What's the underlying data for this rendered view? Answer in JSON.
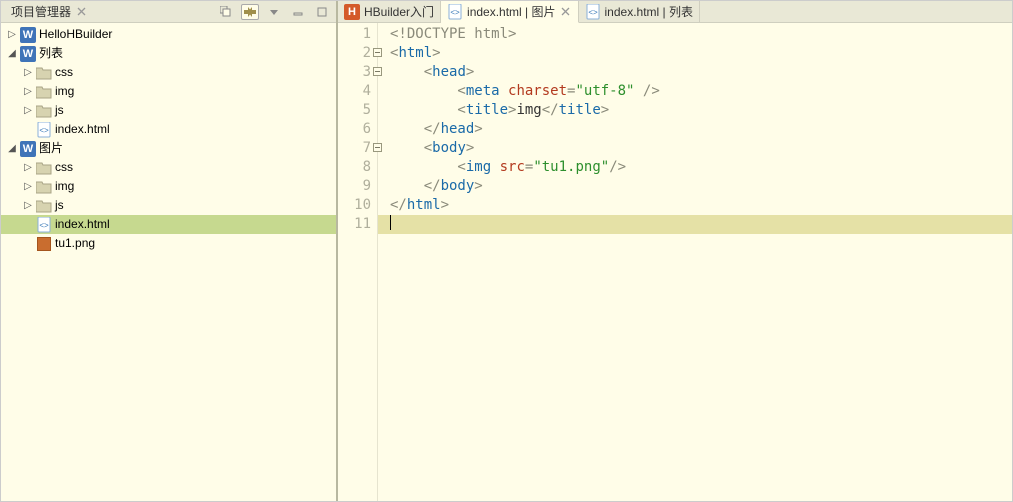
{
  "leftPanel": {
    "title": "项目管理器",
    "nodes": [
      {
        "id": "n0",
        "depth": 0,
        "expanded": false,
        "iconType": "w",
        "label": "HelloHBuilder"
      },
      {
        "id": "n1",
        "depth": 0,
        "expanded": true,
        "iconType": "w",
        "label": "列表"
      },
      {
        "id": "n2",
        "depth": 1,
        "expanded": false,
        "iconType": "folder",
        "label": "css"
      },
      {
        "id": "n3",
        "depth": 1,
        "expanded": false,
        "iconType": "folder",
        "label": "img"
      },
      {
        "id": "n4",
        "depth": 1,
        "expanded": false,
        "iconType": "folder",
        "label": "js"
      },
      {
        "id": "n5",
        "depth": 1,
        "iconType": "html",
        "label": "index.html"
      },
      {
        "id": "n6",
        "depth": 0,
        "expanded": true,
        "iconType": "w",
        "label": "图片"
      },
      {
        "id": "n7",
        "depth": 1,
        "expanded": false,
        "iconType": "folder",
        "label": "css"
      },
      {
        "id": "n8",
        "depth": 1,
        "expanded": false,
        "iconType": "folder",
        "label": "img"
      },
      {
        "id": "n9",
        "depth": 1,
        "expanded": false,
        "iconType": "folder",
        "label": "js"
      },
      {
        "id": "n10",
        "depth": 1,
        "iconType": "html",
        "label": "index.html",
        "selected": true
      },
      {
        "id": "n11",
        "depth": 1,
        "iconType": "img",
        "label": "tu1.png"
      }
    ]
  },
  "editor": {
    "tabs": [
      {
        "id": "t0",
        "icon": "hb",
        "label": "HBuilder入门"
      },
      {
        "id": "t1",
        "icon": "html",
        "label": "index.html | 图片",
        "active": true,
        "closable": true
      },
      {
        "id": "t2",
        "icon": "html",
        "label": "index.html | 列表"
      }
    ],
    "lineCount": 11,
    "foldLines": [
      2,
      3,
      7
    ],
    "activeLine": 11,
    "code": {
      "l1": "<!DOCTYPE html>",
      "l2": "<html>",
      "l3a": "    <",
      "l3b": "head",
      "l3c": ">",
      "l4a": "        <",
      "l4b": "meta",
      "l4c": " ",
      "l4d": "charset",
      "l4e": "=",
      "l4f": "\"utf-8\"",
      "l4g": " />",
      "l5a": "        <",
      "l5b": "title",
      "l5c": ">",
      "l5d": "img",
      "l5e": "</",
      "l5f": "title",
      "l5g": ">",
      "l6a": "    </",
      "l6b": "head",
      "l6c": ">",
      "l7a": "    <",
      "l7b": "body",
      "l7c": ">",
      "l8a": "        <",
      "l8b": "img",
      "l8c": " ",
      "l8d": "src",
      "l8e": "=",
      "l8f": "\"tu1.png\"",
      "l8g": "/>",
      "l9a": "    </",
      "l9b": "body",
      "l9c": ">",
      "l10a": "</",
      "l10b": "html",
      "l10c": ">"
    }
  }
}
